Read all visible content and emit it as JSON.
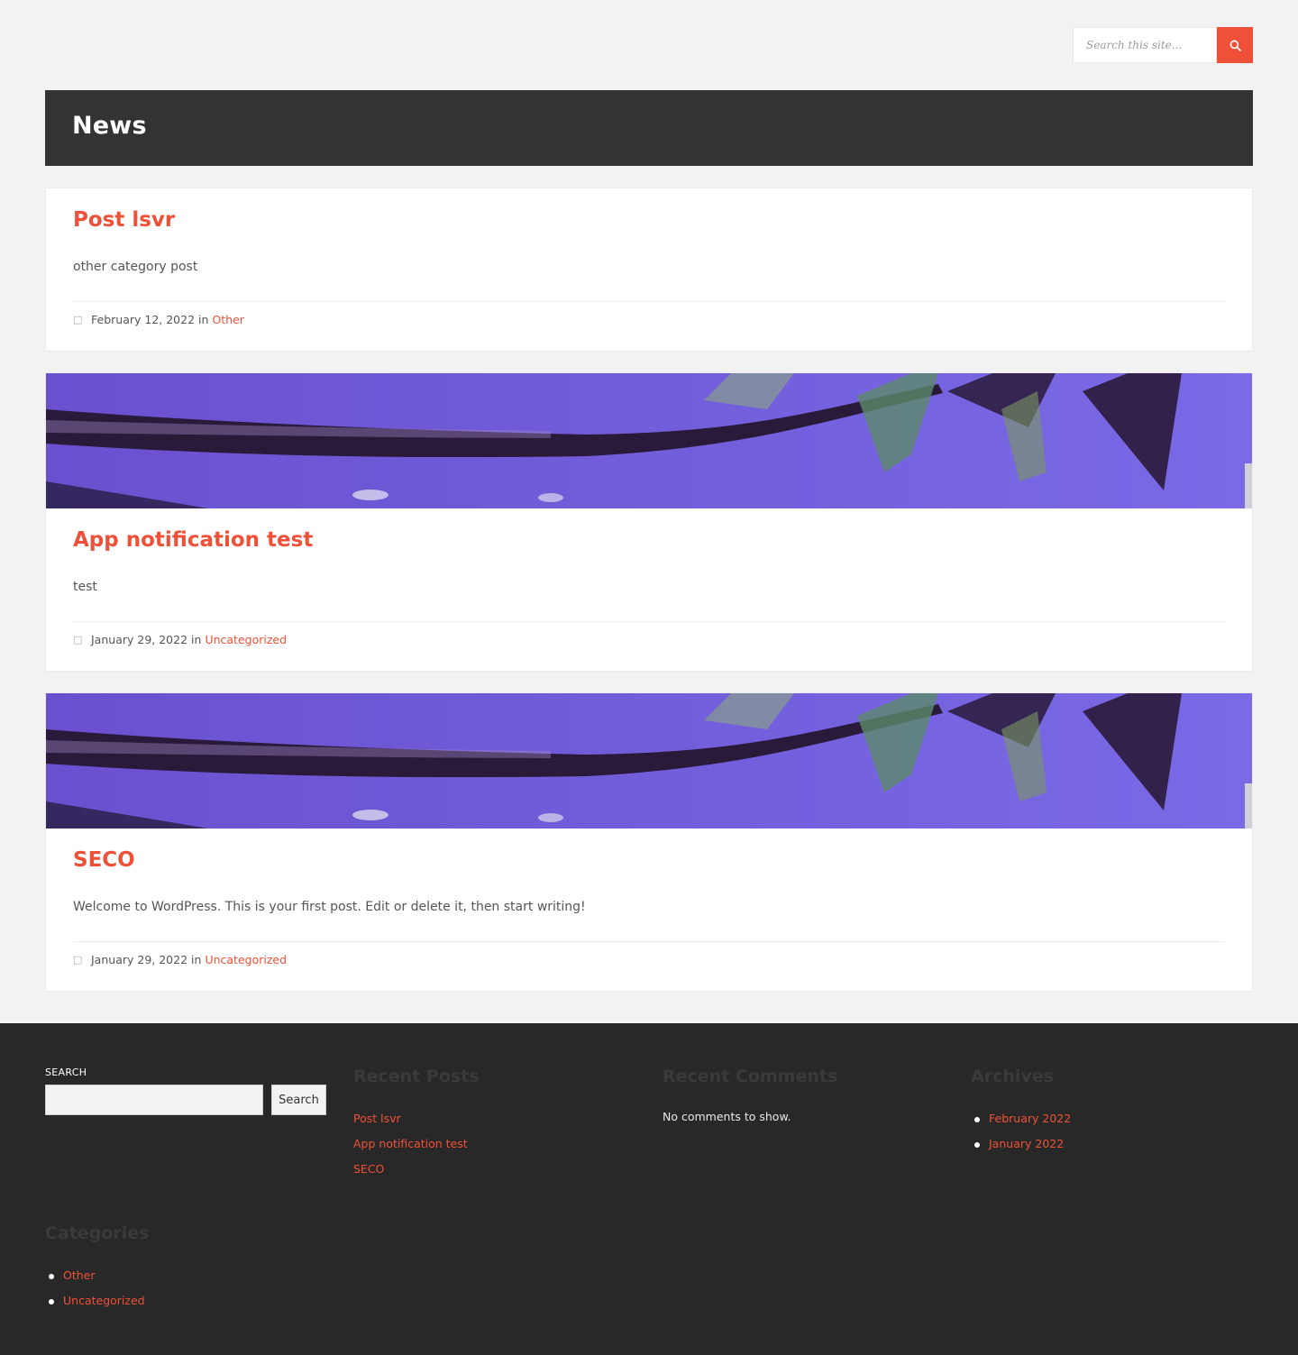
{
  "header": {
    "search_placeholder": "Search this site...",
    "search_icon": "search-icon"
  },
  "page_title": "News",
  "posts": [
    {
      "title": "Post lsvr",
      "excerpt": "other category post",
      "date": "February 12, 2022",
      "in": "in",
      "category": "Other",
      "has_image": false
    },
    {
      "title": "App notification test",
      "excerpt": "test",
      "date": "January 29, 2022",
      "in": "in",
      "category": "Uncategorized",
      "has_image": true
    },
    {
      "title": "SECO",
      "excerpt": "Welcome to WordPress. This is your first post. Edit or delete it, then start writing!",
      "date": "January 29, 2022",
      "in": "in",
      "category": "Uncategorized",
      "has_image": true
    }
  ],
  "footer": {
    "search": {
      "label": "SEARCH",
      "button": "Search"
    },
    "recent_posts": {
      "title": "Recent Posts",
      "items": [
        "Post lsvr",
        "App notification test",
        "SECO"
      ]
    },
    "recent_comments": {
      "title": "Recent Comments",
      "empty": "No comments to show."
    },
    "archives": {
      "title": "Archives",
      "items": [
        "February 2022",
        "January 2022"
      ]
    },
    "categories": {
      "title": "Categories",
      "items": [
        "Other",
        "Uncategorized"
      ]
    }
  },
  "colors": {
    "accent": "#ef5138",
    "title_bar": "#333333",
    "footer": "#282828",
    "page_bg": "#f2f2f2"
  }
}
